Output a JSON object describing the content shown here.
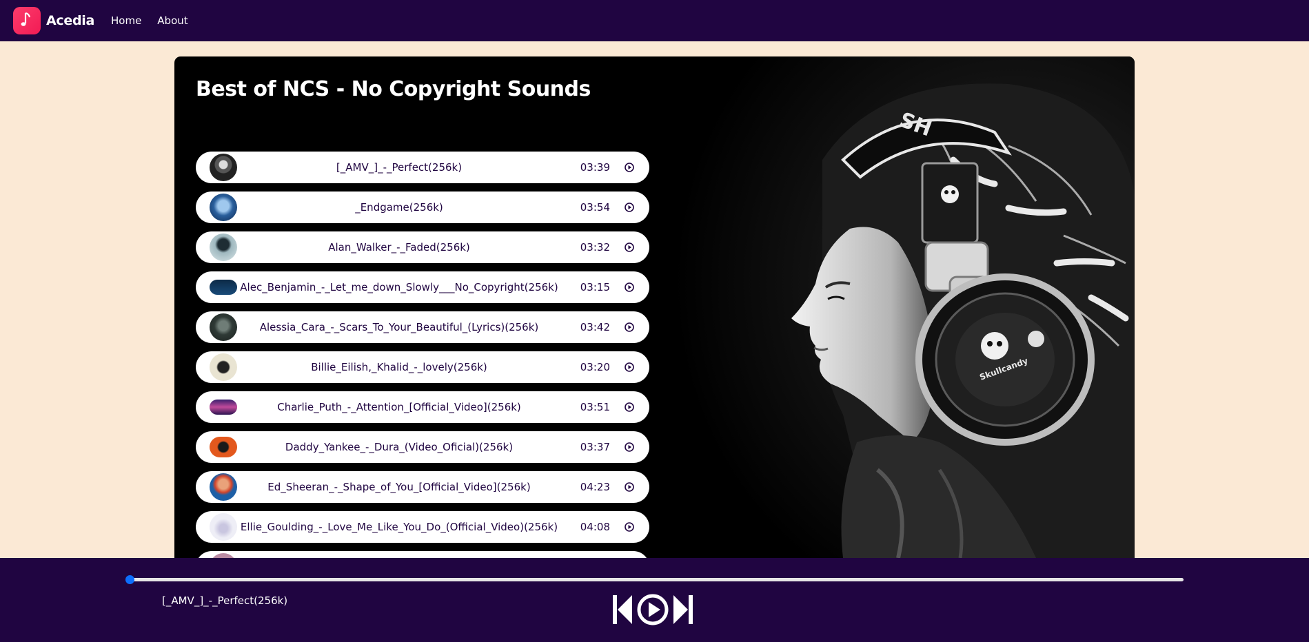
{
  "nav": {
    "brand": "Acedia",
    "links": [
      "Home",
      "About"
    ]
  },
  "playlist": {
    "title": "Best of NCS - No Copyright Sounds",
    "songs": [
      {
        "name": "[_AMV_]_-_Perfect(256k)",
        "duration": "03:39"
      },
      {
        "name": "_Endgame(256k)",
        "duration": "03:54"
      },
      {
        "name": "Alan_Walker_-_Faded(256k)",
        "duration": "03:32"
      },
      {
        "name": "Alec_Benjamin_-_Let_me_down_Slowly___No_Copyright(256k)",
        "duration": "03:15"
      },
      {
        "name": "Alessia_Cara_-_Scars_To_Your_Beautiful_(Lyrics)(256k)",
        "duration": "03:42"
      },
      {
        "name": "Billie_Eilish,_Khalid_-_lovely(256k)",
        "duration": "03:20"
      },
      {
        "name": "Charlie_Puth_-_Attention_[Official_Video](256k)",
        "duration": "03:51"
      },
      {
        "name": "Daddy_Yankee_-_Dura_(Video_Oficial)(256k)",
        "duration": "03:37"
      },
      {
        "name": "Ed_Sheeran_-_Shape_of_You_[Official_Video](256k)",
        "duration": "04:23"
      },
      {
        "name": "Ellie_Goulding_-_Love_Me_Like_You_Do_(Official_Video)(256k)",
        "duration": "04:08"
      }
    ]
  },
  "player": {
    "current_song": "[_AMV_]_-_Perfect(256k)",
    "progress": 0
  },
  "icons": {
    "logo": "music-note-icon",
    "song_play": "play-circle-icon",
    "previous": "skip-previous-icon",
    "play": "play-circle-icon",
    "next": "skip-next-icon"
  },
  "colors": {
    "navbar": "#200541",
    "background": "#fbe9d5",
    "accent": "#f21b54",
    "progress_thumb": "#0d6efd"
  }
}
